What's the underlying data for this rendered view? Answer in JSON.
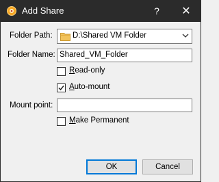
{
  "window": {
    "title": "Add Share",
    "help_glyph": "?",
    "close_glyph": "✕"
  },
  "form": {
    "folder_path_label": "Folder Path:",
    "folder_path_value": "D:\\Shared VM Folder",
    "folder_name_label": "Folder Name:",
    "folder_name_value": "Shared_VM_Folder",
    "read_only": {
      "label_accel": "R",
      "label_rest": "ead-only",
      "checked": false
    },
    "auto_mount": {
      "label_accel": "A",
      "label_rest": "uto-mount",
      "checked": true
    },
    "mount_point_label": "Mount point:",
    "mount_point_value": "",
    "make_permanent": {
      "label_accel": "M",
      "label_rest": "ake Permanent",
      "checked": false
    }
  },
  "buttons": {
    "ok": "OK",
    "cancel": "Cancel"
  },
  "colors": {
    "titlebar": "#2b2b2b",
    "folder_icon": "#f2c35b",
    "default_button_border": "#0078d7"
  }
}
